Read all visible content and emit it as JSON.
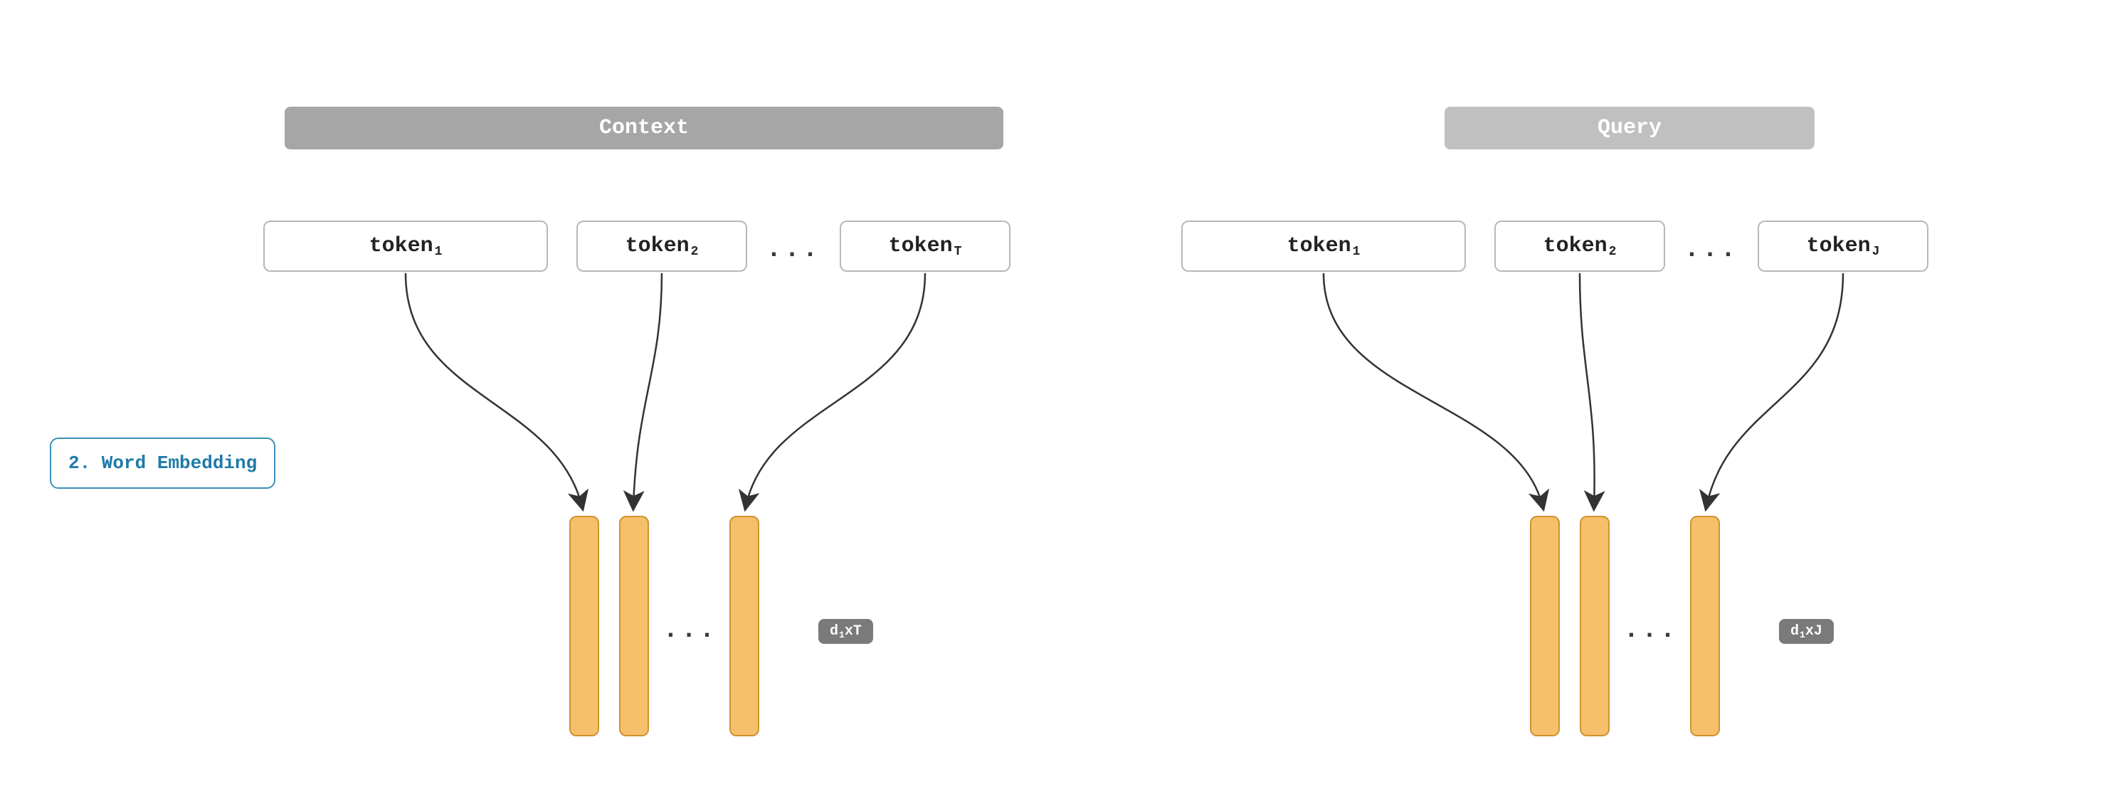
{
  "headers": {
    "context": "Context",
    "query": "Query"
  },
  "tokens": {
    "context": {
      "t1": {
        "label": "token",
        "sub": "1"
      },
      "t2": {
        "label": "token",
        "sub": "2"
      },
      "tlast": {
        "label": "token",
        "sub": "T"
      }
    },
    "query": {
      "t1": {
        "label": "token",
        "sub": "1"
      },
      "t2": {
        "label": "token",
        "sub": "2"
      },
      "tlast": {
        "label": "token",
        "sub": "J"
      }
    }
  },
  "step": {
    "label": "2. Word Embedding"
  },
  "dots": "...",
  "dims": {
    "context": {
      "d": "d",
      "dsub": "1",
      "mult": " x ",
      "n": "T"
    },
    "query": {
      "d": "d",
      "dsub": "1",
      "mult": " x ",
      "n": "J"
    }
  }
}
